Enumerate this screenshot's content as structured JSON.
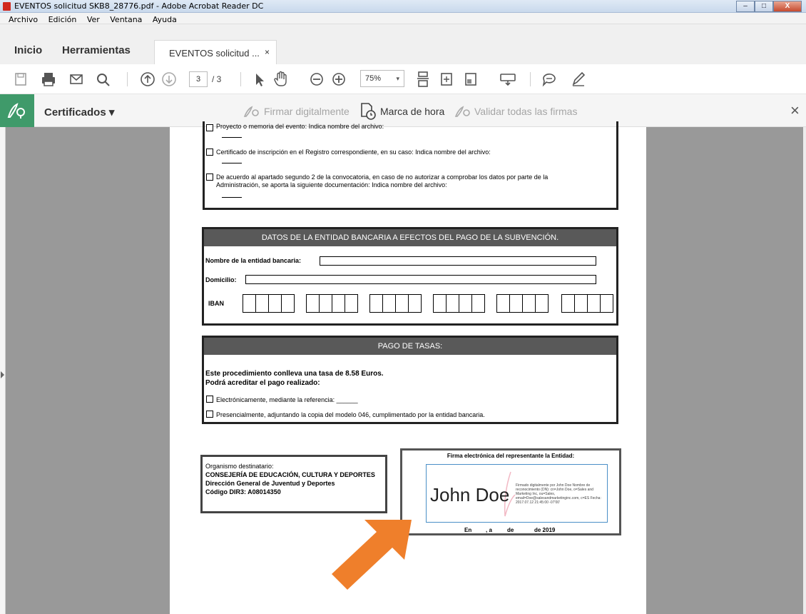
{
  "window": {
    "title": "EVENTOS solicitud SKB8_28776.pdf - Adobe Acrobat Reader DC",
    "buttons": [
      "–",
      "□",
      "X"
    ]
  },
  "menu": [
    "Archivo",
    "Edición",
    "Ver",
    "Ventana",
    "Ayuda"
  ],
  "tabs": {
    "home": "Inicio",
    "tools": "Herramientas",
    "document": "EVENTOS solicitud ...",
    "close": "×"
  },
  "toolbar": {
    "page_current": "3",
    "page_total": "/ 3",
    "zoom": "75%",
    "icons": [
      "save-icon",
      "print-icon",
      "email-icon",
      "search-icon",
      "page-up-icon",
      "page-down-icon",
      "select-cursor-icon",
      "hand-icon",
      "zoom-out-icon",
      "zoom-in-icon",
      "fit-page-icon",
      "scroll-mode-icon",
      "full-screen-icon",
      "keyboard-icon",
      "comment-icon",
      "pen-icon"
    ]
  },
  "certbar": {
    "label": "Certificados ▾",
    "sign": "Firmar digitalmente",
    "timestamp": "Marca de hora",
    "validate": "Validar todas las firmas",
    "close": "×"
  },
  "doc": {
    "item_project": "Proyecto o memoria del evento: Indica nombre del archivo:",
    "item_certificate": "Certificado de inscripción en el Registro correspondiente, en su caso: Indica nombre del archivo:",
    "item_agreement_1": "De acuerdo al apartado segundo 2 de la convocatoria, en caso de no autorizar a comprobar los datos por parte de la",
    "item_agreement_2": "Administración, se aporta la siguiente documentación: Indica nombre del archivo:",
    "bank_header": "DATOS DE LA ENTIDAD BANCARIA A EFECTOS DEL PAGO DE LA SUBVENCIÓN.",
    "bank_name_label": "Nombre de la entidad bancaria:",
    "address_label": "Domicilio:",
    "iban_label": "IBAN",
    "fees_header": "PAGO DE TASAS:",
    "fees_text_1": "Este procedimiento conlleva una tasa de 8.58 Euros.",
    "fees_text_2": "Podrá acreditar el pago realizado:",
    "fees_option_1": "Electrónicamente, mediante la referencia: ______",
    "fees_option_2": "Presencialmente, adjuntando la copia del modelo 046, cumplimentado por la entidad bancaria.",
    "recipient_1": "Organismo destinatario:",
    "recipient_2": "CONSEJERÍA DE EDUCACIÓN, CULTURA Y DEPORTES",
    "recipient_3": "Dirección General de Juventud y Deportes",
    "recipient_4": "Código DIR3: A08014350",
    "signature_title": "Firma electrónica del representante la Entidad:",
    "signature_name": "John Doe",
    "signature_details": "Firmado digitalmente por John Doe Nombre de reconocimiento (DN): cn=John Doe, o=Sales and Marketing Inc, ou=Sales, email=Doe@salesandmarketinginc.com, c=ES Fecha: 2017.07.12 21:45:00 -07'00'",
    "date_en": "En",
    "date_a": ", a",
    "date_de": "de",
    "date_year": "de 2019"
  },
  "colors": {
    "arrow": "#ef7f2b",
    "cert_green": "#3f9a6a",
    "header_gray": "#595959",
    "signature_border": "#4a8fc7"
  }
}
